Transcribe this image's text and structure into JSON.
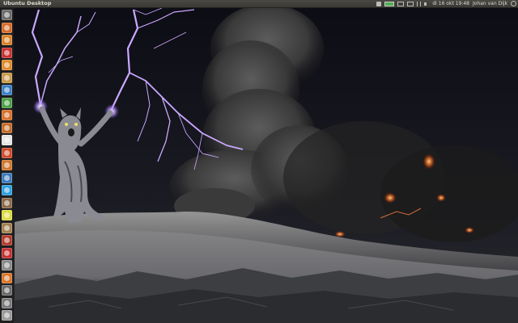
{
  "panel": {
    "title": "Ubuntu Desktop",
    "clock": "di 16 okt 19:48",
    "user": "Johan van Dijk"
  },
  "launcher": {
    "items": [
      {
        "name": "dash-home",
        "color": "#6a6a6a"
      },
      {
        "name": "files",
        "color": "#d86a2a"
      },
      {
        "name": "firefox",
        "color": "#d9822b"
      },
      {
        "name": "opera",
        "color": "#c8302f"
      },
      {
        "name": "banshee",
        "color": "#e08a2c"
      },
      {
        "name": "app-grid",
        "color": "#c99a4a"
      },
      {
        "name": "writer",
        "color": "#3a7fc4"
      },
      {
        "name": "calc",
        "color": "#4aa046"
      },
      {
        "name": "impress",
        "color": "#d8702a"
      },
      {
        "name": "docs",
        "color": "#c46a2a"
      },
      {
        "name": "pdf",
        "color": "#e4e4e4"
      },
      {
        "name": "ubuntu-one",
        "color": "#d04a2a"
      },
      {
        "name": "software-center",
        "color": "#d0772f"
      },
      {
        "name": "thunderbird",
        "color": "#3c7bbd"
      },
      {
        "name": "skype",
        "color": "#2ea0e0"
      },
      {
        "name": "gimp",
        "color": "#8a6a4a"
      },
      {
        "name": "radiation",
        "color": "#dcdc40"
      },
      {
        "name": "gimp-wilber",
        "color": "#a38050"
      },
      {
        "name": "terminal",
        "color": "#b33a2a"
      },
      {
        "name": "transmission",
        "color": "#c43030"
      },
      {
        "name": "settings",
        "color": "#8a8a8a"
      },
      {
        "name": "updates",
        "color": "#d8772a"
      },
      {
        "name": "system",
        "color": "#6a6a6a"
      },
      {
        "name": "workspaces",
        "color": "#7a7a7a"
      },
      {
        "name": "trash",
        "color": "#9a9a9a"
      }
    ]
  },
  "colors": {
    "panel_bg": "#3c3b37",
    "launcher_bg": "#1e1e1e",
    "lightning": "#b690ff"
  }
}
